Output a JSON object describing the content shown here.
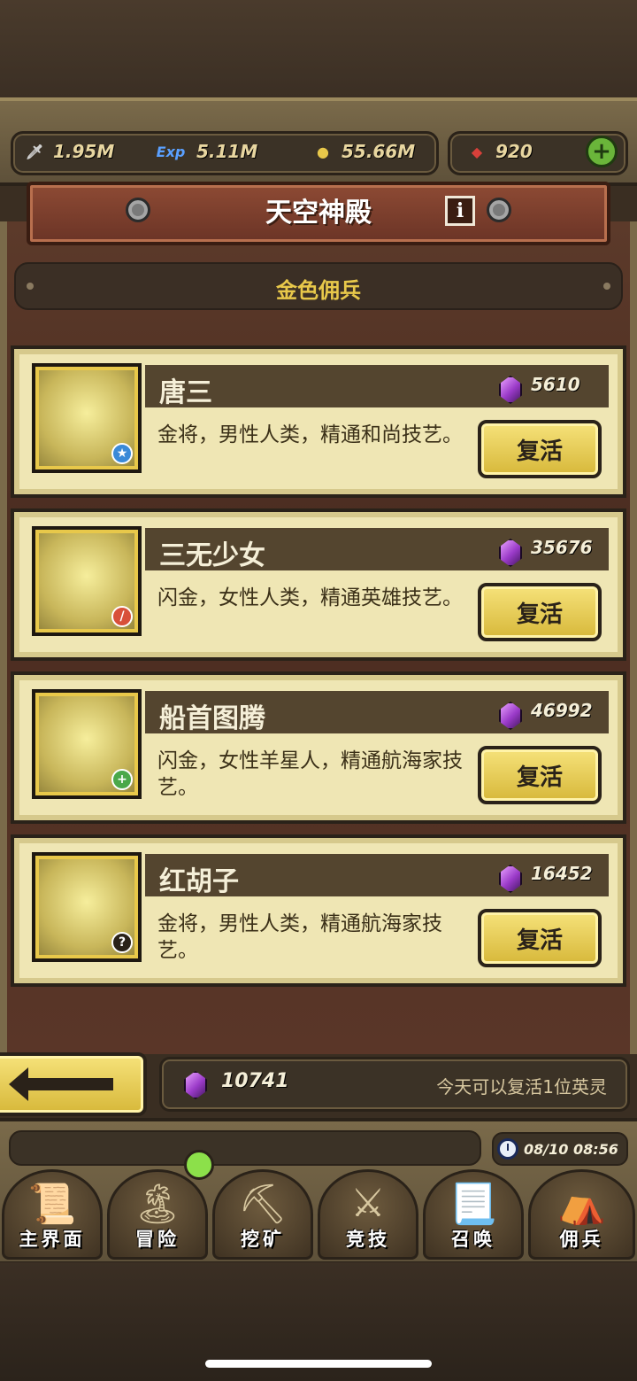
{
  "resources": {
    "attack": "1.95M",
    "exp": "5.11M",
    "gold": "55.66M",
    "gems": "920"
  },
  "header": {
    "title": "天空神殿",
    "subtitle": "金色佣兵"
  },
  "heroes": [
    {
      "name": "唐三",
      "cost": "5610",
      "desc": "金将，男性人类，精通和尚技艺。",
      "revive_label": "复活"
    },
    {
      "name": "三无少女",
      "cost": "35676",
      "desc": "闪金，女性人类，精通英雄技艺。",
      "revive_label": "复活"
    },
    {
      "name": "船首图腾",
      "cost": "46992",
      "desc": "闪金，女性羊星人，精通航海家技艺。",
      "revive_label": "复活"
    },
    {
      "name": "红胡子",
      "cost": "16452",
      "desc": "金将，男性人类，精通航海家技艺。",
      "revive_label": "复活"
    }
  ],
  "footer": {
    "balance": "10741",
    "daily_note": "今天可以复活1位英灵"
  },
  "clock": "08/10 08:56",
  "nav": [
    {
      "label": "主界面",
      "icon": "map-scroll-icon"
    },
    {
      "label": "冒险",
      "icon": "island-icon"
    },
    {
      "label": "挖矿",
      "icon": "pickaxe-icon"
    },
    {
      "label": "竞技",
      "icon": "crossed-swords-icon"
    },
    {
      "label": "召唤",
      "icon": "summon-scroll-icon"
    },
    {
      "label": "佣兵",
      "icon": "tent-icon"
    }
  ]
}
